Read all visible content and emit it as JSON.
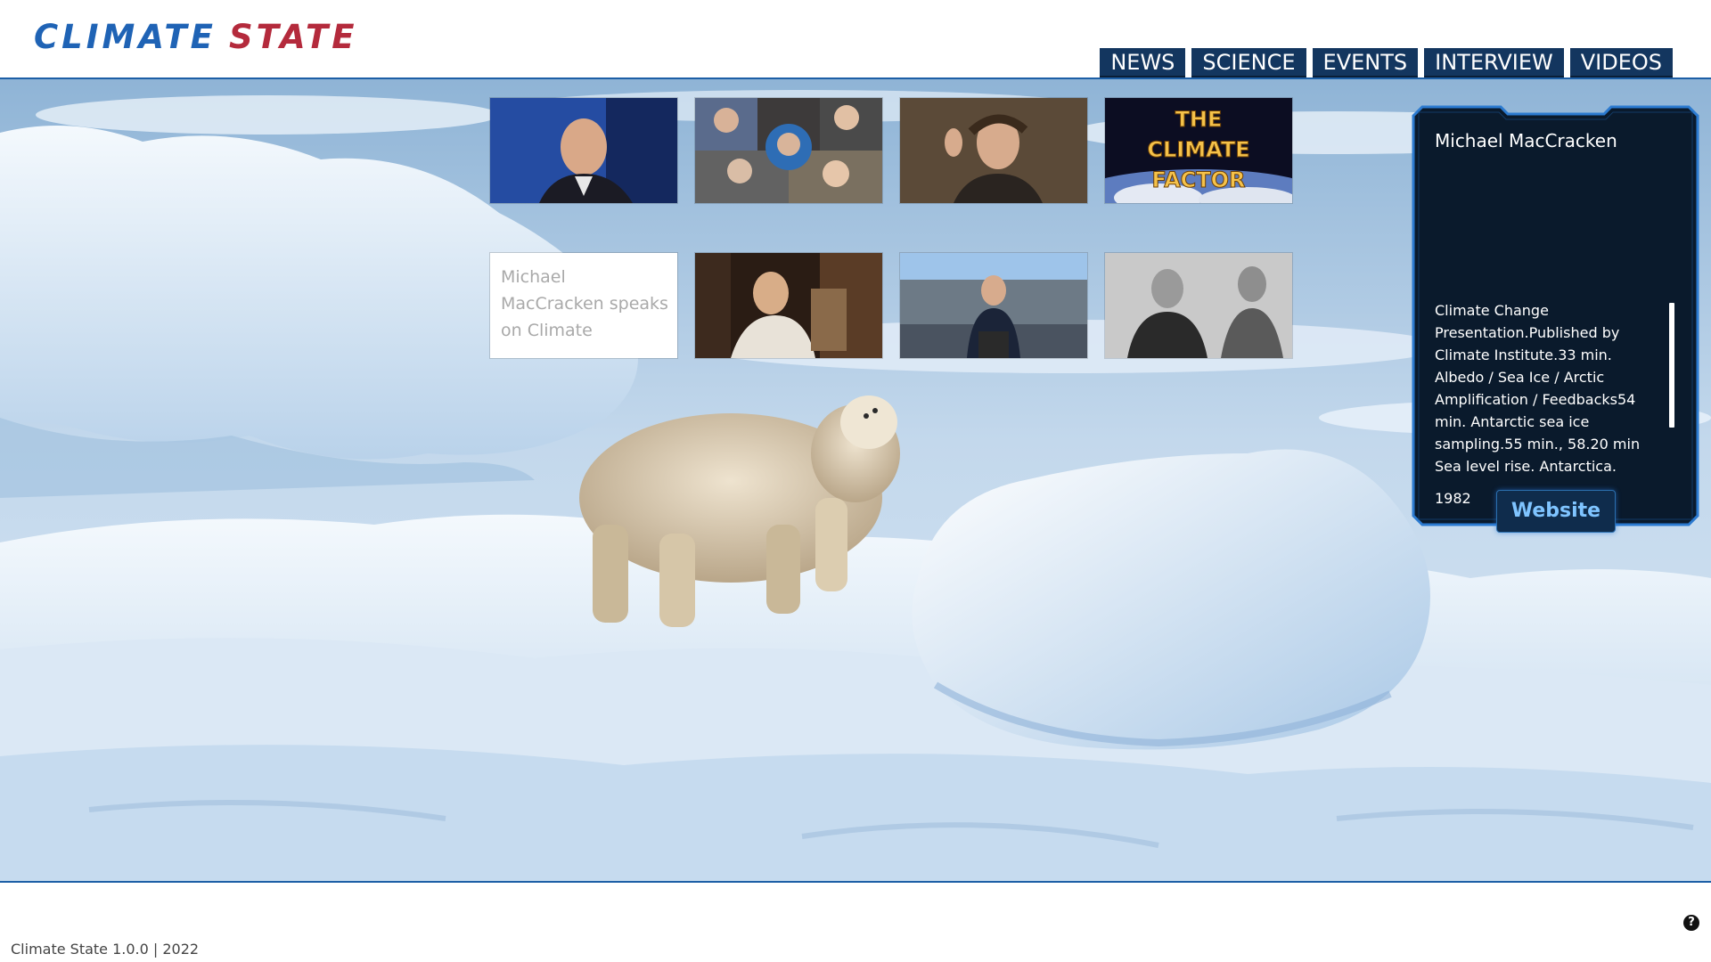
{
  "header": {
    "logo_word1": "CLIMATE",
    "logo_word2": "STATE",
    "nav": [
      "NEWS",
      "SCIENCE",
      "EVENTS",
      "INTERVIEW",
      "VIDEOS"
    ]
  },
  "colors": {
    "brand_blue": "#1f63b5",
    "brand_red": "#b42a3c",
    "nav_bg": "#13365f",
    "panel_bg": "#0a1a2c",
    "accent_line": "#1d5fa6"
  },
  "thumbnails": [
    {
      "label": "",
      "icon": "video-thumbnail"
    },
    {
      "label": "",
      "icon": "video-thumbnail"
    },
    {
      "label": "",
      "icon": "video-thumbnail"
    },
    {
      "label": "THE CLIMATE FACTOR",
      "line1": "THE",
      "line2": "CLIMATE",
      "line3": "FACTOR",
      "icon": "video-thumbnail"
    },
    {
      "label": "Michael MacCracken speaks on Climate",
      "icon": "none"
    },
    {
      "label": "",
      "icon": "video-thumbnail"
    },
    {
      "label": "",
      "icon": "video-thumbnail"
    },
    {
      "label": "",
      "icon": "video-thumbnail"
    }
  ],
  "info_panel": {
    "title": "Michael MacCracken",
    "description": "Climate Change Presentation.Published by Climate Institute.33 min. Albedo / Sea Ice / Arctic Amplification / Feedbacks54 min. Antarctic sea ice sampling.55 min., 58.20 min Sea level rise. Antarctica. Mentions Walter Cronkite, who took part",
    "year": "1982",
    "website_label": "Website"
  },
  "footer": {
    "version": "Climate State 1.0.0 | 2022",
    "help_icon": "question-mark-icon",
    "help_glyph": "?"
  }
}
